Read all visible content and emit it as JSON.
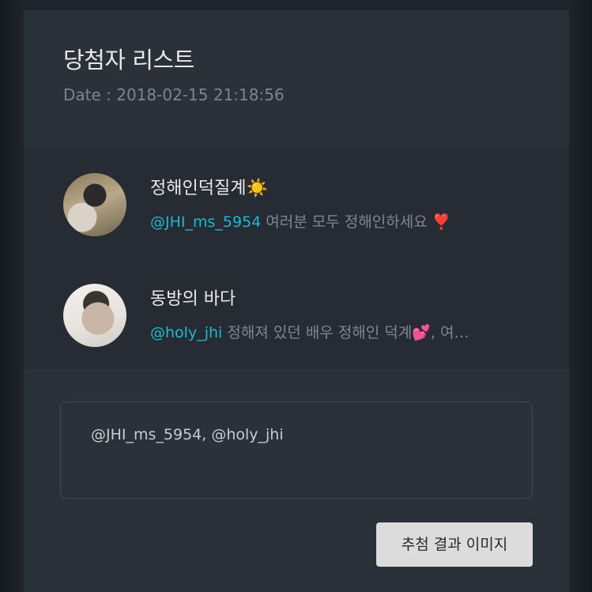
{
  "header": {
    "title": "당첨자 리스트",
    "date": "Date : 2018-02-15 21:18:56"
  },
  "winners": [
    {
      "name": "정해인덕질계☀️",
      "mention": "@JHI_ms_5954",
      "text": " 여러분 모두 정해인하세요 ❣️"
    },
    {
      "name": "동방의 바다",
      "mention": "@holy_jhi",
      "text": " 정해져 있던 배우 정해인 덕계💕, 여…"
    }
  ],
  "result": {
    "text": "@JHI_ms_5954, @holy_jhi"
  },
  "actions": {
    "image_button_label": "추첨 결과 이미지"
  },
  "colors": {
    "mention": "#1fb8d4",
    "card_bg": "#2b3138",
    "list_bg": "#262c32",
    "button_bg": "#dcdcdc"
  }
}
